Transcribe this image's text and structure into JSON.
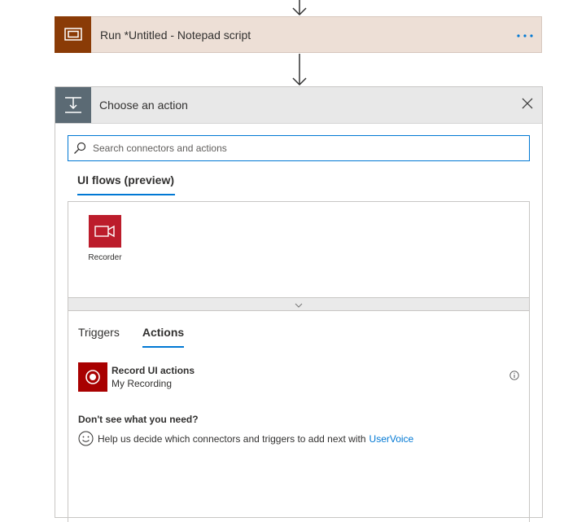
{
  "run_step": {
    "title": "Run *Untitled - Notepad script",
    "icon": "run-script-icon",
    "more_icon": "more-ellipsis-icon"
  },
  "panel": {
    "title": "Choose an action",
    "icon": "choose-action-icon",
    "close_icon": "close-icon",
    "search": {
      "placeholder": "Search connectors and actions",
      "value": ""
    },
    "connectors_tab": "UI flows (preview)",
    "connectors": [
      {
        "label": "Recorder",
        "icon": "video-camera-icon",
        "color": "#bc1c2b"
      }
    ],
    "result_tabs": [
      {
        "label": "Triggers",
        "active": false
      },
      {
        "label": "Actions",
        "active": true
      }
    ],
    "actions": [
      {
        "title": "Record UI actions",
        "subtitle": "My Recording",
        "icon": "record-icon",
        "color": "#a80000"
      }
    ],
    "help": {
      "title": "Don't see what you need?",
      "text": "Help us decide which connectors and triggers to add next with",
      "link": "UserVoice"
    }
  },
  "colors": {
    "accent": "#0078d4",
    "run_icon_bg": "#8a3b06",
    "run_card_bg": "#eddfd6",
    "panel_icon_bg": "#5b6a74"
  }
}
